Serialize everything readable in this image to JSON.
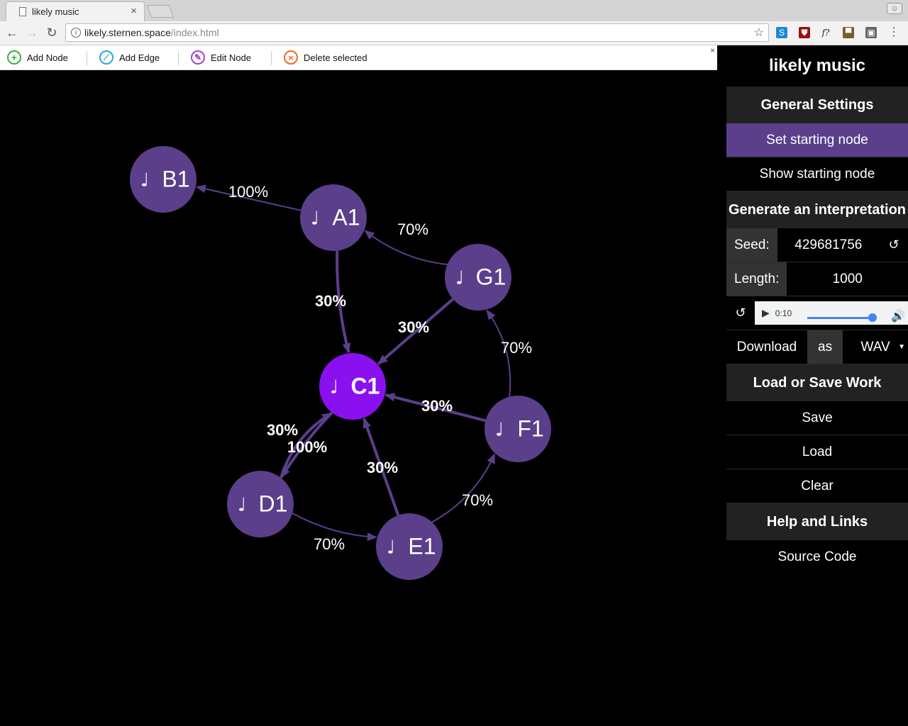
{
  "browser": {
    "tab_title": "likely music",
    "url_host": "likely.sternen.space",
    "url_path": "/index.html"
  },
  "vis_toolbar": {
    "add_node": "Add Node",
    "add_edge": "Add Edge",
    "edit_node": "Edit Node",
    "delete_selected": "Delete selected"
  },
  "graph": {
    "note_glyph": "♩",
    "colors": {
      "node": "#5b3f8a",
      "selected_node": "#8b10f0",
      "edge": "#5b3f8a",
      "label": "#ffffff"
    },
    "nodes": [
      {
        "id": "B1",
        "label": "B1"
      },
      {
        "id": "A1",
        "label": "A1"
      },
      {
        "id": "G1",
        "label": "G1"
      },
      {
        "id": "C1",
        "label": "C1",
        "selected": true
      },
      {
        "id": "F1",
        "label": "F1"
      },
      {
        "id": "D1",
        "label": "D1"
      },
      {
        "id": "E1",
        "label": "E1"
      }
    ],
    "edges": [
      {
        "from": "A1",
        "to": "B1",
        "label": "100%",
        "bold": false
      },
      {
        "from": "G1",
        "to": "A1",
        "label": "70%",
        "bold": false
      },
      {
        "from": "A1",
        "to": "C1",
        "label": "30%",
        "bold": true
      },
      {
        "from": "G1",
        "to": "C1",
        "label": "30%",
        "bold": true
      },
      {
        "from": "F1",
        "to": "G1",
        "label": "70%",
        "bold": false
      },
      {
        "from": "F1",
        "to": "C1",
        "label": "30%",
        "bold": true
      },
      {
        "from": "D1",
        "to": "C1",
        "label": "30%",
        "bold": true
      },
      {
        "from": "C1",
        "to": "D1",
        "label": "100%",
        "bold": true
      },
      {
        "from": "E1",
        "to": "C1",
        "label": "30%",
        "bold": true
      },
      {
        "from": "D1",
        "to": "E1",
        "label": "70%",
        "bold": false
      },
      {
        "from": "E1",
        "to": "F1",
        "label": "70%",
        "bold": false
      }
    ]
  },
  "sidebar": {
    "title": "likely music",
    "general_settings": "General Settings",
    "set_starting_node": "Set starting node",
    "show_starting_node": "Show starting node",
    "generate_interpretation": "Generate an interpretation",
    "seed_label": "Seed:",
    "seed_value": "429681756",
    "length_label": "Length:",
    "length_value": "1000",
    "audio_time": "0:10",
    "download_label": "Download",
    "as_label": "as",
    "format_value": "WAV",
    "load_save_work": "Load or Save Work",
    "save": "Save",
    "load": "Load",
    "clear": "Clear",
    "help_links": "Help and Links",
    "source_code": "Source Code"
  }
}
